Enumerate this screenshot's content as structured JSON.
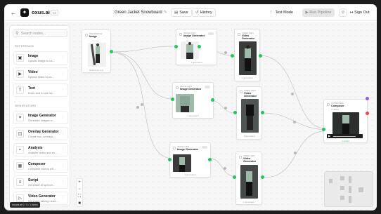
{
  "topbar": {
    "back_icon": "arrow-left-icon",
    "brand": "oxus.ai",
    "version": "v3",
    "project": "Green Jacket Snowboard",
    "save": "Save",
    "history": "History",
    "text_mode": "Text Mode",
    "run_pipeline": "Run Pipeline",
    "sign_out": "Sign Out"
  },
  "sidebar": {
    "search_placeholder": "Search nodes...",
    "section_reference": "REFERENCE",
    "section_generators": "GENERATORS",
    "items": [
      {
        "name": "Image",
        "desc": "Upload image to us...",
        "icon": "image-icon"
      },
      {
        "name": "Video",
        "desc": "Upload video to us...",
        "icon": "video-icon"
      },
      {
        "name": "Text",
        "desc": "Enter text to use as...",
        "icon": "text-icon"
      },
      {
        "name": "Image Generator",
        "desc": "Generate images w...",
        "icon": "image-generator-icon"
      },
      {
        "name": "Overlay Generator",
        "desc": "Create two overlays...",
        "icon": "overlay-icon"
      },
      {
        "name": "Analysis",
        "desc": "Analyze video and ex...",
        "icon": "analysis-icon"
      },
      {
        "name": "Composer",
        "desc": "Compose videos wit...",
        "icon": "composer-icon"
      },
      {
        "name": "Script",
        "desc": "Generate ai speech...",
        "icon": "script-icon"
      },
      {
        "name": "Video Generator",
        "desc": "Generate talking head...",
        "icon": "video-generator-icon"
      }
    ]
  },
  "toast": "Issues at 0 / 0 / 1 items",
  "nodes": {
    "image": {
      "tag": "REFERENCE",
      "title": "Image",
      "caption": "Reference img"
    },
    "imggen1": {
      "tag": "IMAGE GEN",
      "title": "Image Generator",
      "caption": "1 generated"
    },
    "imggen2": {
      "tag": "IMAGE GEN",
      "title": "Image Generator",
      "caption": "1 generated"
    },
    "imggen3": {
      "tag": "IMAGE GEN",
      "title": "Image Generator",
      "caption": "1 generated"
    },
    "vidgen1": {
      "tag": "VIDEO GEN",
      "title": "Video Generator",
      "caption": "1 generated"
    },
    "vidgen2": {
      "tag": "VIDEO GEN",
      "title": "Video Generator",
      "caption": "1 generated"
    },
    "vidgen3": {
      "tag": "VIDEO GEN",
      "title": "Video Generator",
      "caption": "1 generated"
    },
    "composer": {
      "tag": "COMPOSER",
      "title": "Composer",
      "subtitle": "3 videos",
      "time": "0:00",
      "caption": "1 output"
    }
  },
  "colors": {
    "accent": "#22c55e",
    "jacket": "#9fb9ab",
    "badge_red": "#ef4444",
    "badge_purple": "#8b5cf6"
  }
}
